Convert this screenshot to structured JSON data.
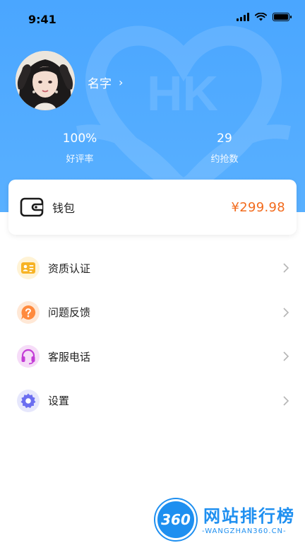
{
  "status_bar": {
    "time": "9:41"
  },
  "profile": {
    "name": "名字",
    "chevron": "›"
  },
  "stats": [
    {
      "value": "100%",
      "label": "好评率"
    },
    {
      "value": "29",
      "label": "约抢数"
    }
  ],
  "wallet": {
    "label": "钱包",
    "balance": "¥299.98"
  },
  "menu": [
    {
      "label": "资质认证",
      "icon": "id-card-icon",
      "color": "#f7b324"
    },
    {
      "label": "问题反馈",
      "icon": "question-bubble-icon",
      "color": "#ff8a3d"
    },
    {
      "label": "客服电话",
      "icon": "headset-icon",
      "color": "#c33cd6"
    },
    {
      "label": "设置",
      "icon": "gear-icon",
      "color": "#6b6ef0"
    }
  ],
  "watermark": {
    "title": "网站排行榜",
    "url": "-WANGZHAN360.CN-",
    "logo": "360"
  },
  "colors": {
    "header": "#4aa6ff",
    "accent_orange": "#f26b1d",
    "brand_blue": "#1e8ff0"
  }
}
